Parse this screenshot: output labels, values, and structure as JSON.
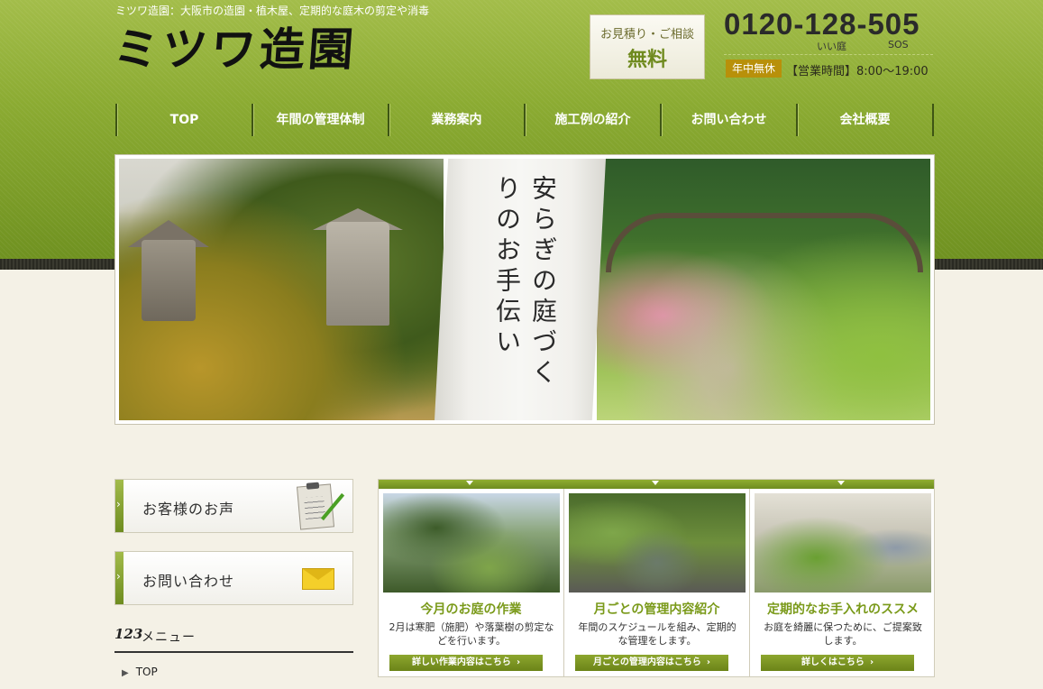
{
  "header": {
    "tagline": "ミツワ造園：大阪市の造園・植木屋、定期的な庭木の剪定や消毒",
    "logo": "ミツワ造園",
    "estimate_line1": "お見積り・ご相談",
    "estimate_line2": "無料",
    "phone": "0120-128-505",
    "phone_sub1": "いい庭",
    "phone_sub2": "SOS",
    "open_badge": "年中無休",
    "hours": "【営業時間】8:00～19:00"
  },
  "nav": [
    {
      "label": "TOP"
    },
    {
      "label": "年間の管理体制"
    },
    {
      "label": "業務案内"
    },
    {
      "label": "施工例の紹介"
    },
    {
      "label": "お問い合わせ"
    },
    {
      "label": "会社概要"
    }
  ],
  "hero": {
    "copy": "安らぎの庭づくりのお手伝い"
  },
  "sidebar": {
    "voice_label": "お客様のお声",
    "contact_label": "お問い合わせ",
    "menu_icon": "123",
    "menu_title": "メニュー",
    "menu_items": [
      {
        "label": "TOP"
      }
    ]
  },
  "features": [
    {
      "title": "今月のお庭の作業",
      "desc": "2月は寒肥（施肥）や落葉樹の剪定などを行います。",
      "button": "詳しい作業内容はこちら"
    },
    {
      "title": "月ごとの管理内容紹介",
      "desc": "年間のスケジュールを組み、定期的な管理をします。",
      "button": "月ごとの管理内容はこちら"
    },
    {
      "title": "定期的なお手入れのススメ",
      "desc": "お庭を綺麗に保つために、ご提案致します。",
      "button": "詳しくはこちら"
    }
  ],
  "colors": {
    "brand_green": "#7a9a1a",
    "badge_gold": "#b8900a"
  }
}
